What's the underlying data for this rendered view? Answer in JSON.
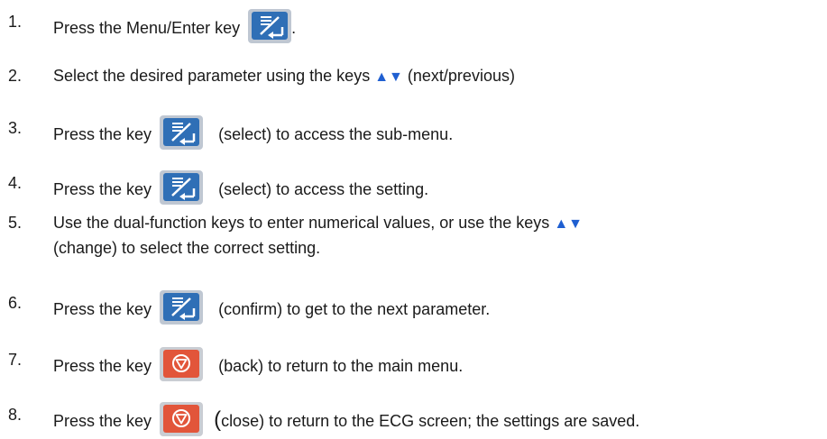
{
  "steps": [
    {
      "num": "1.",
      "before": "Press the Menu/Enter key",
      "after": ".",
      "key": "menu-enter-icon"
    },
    {
      "num": "2.",
      "before": "Select the desired parameter using the keys",
      "arrows": "▲▼",
      "after": "(next/previous)"
    },
    {
      "num": "3.",
      "before": "Press the key",
      "after": "(select) to access the sub-menu.",
      "key": "menu-enter-icon"
    },
    {
      "num": "4.",
      "before": "Press the key",
      "after": "(select) to access the setting.",
      "key": "menu-enter-icon"
    },
    {
      "num": "5.",
      "line1_before": "Use the dual-function keys to enter numerical values, or use the keys",
      "arrows": "▲▼",
      "line2": "(change) to select the correct setting."
    },
    {
      "num": "6.",
      "before": "Press the key",
      "after": "(confirm) to get to the next parameter.",
      "key": "menu-enter-icon"
    },
    {
      "num": "7.",
      "before": "Press the key",
      "after": "(back) to return to the main menu.",
      "key": "stop-back-icon"
    },
    {
      "num": "8.",
      "before": "Press the key",
      "paren": "(",
      "after": "close)  to return to the ECG screen; the settings are saved.",
      "key": "stop-back-icon"
    }
  ],
  "colors": {
    "enter_key": "#2f6fb6",
    "back_key": "#e2553a",
    "arrows": "#1f5fd1"
  }
}
